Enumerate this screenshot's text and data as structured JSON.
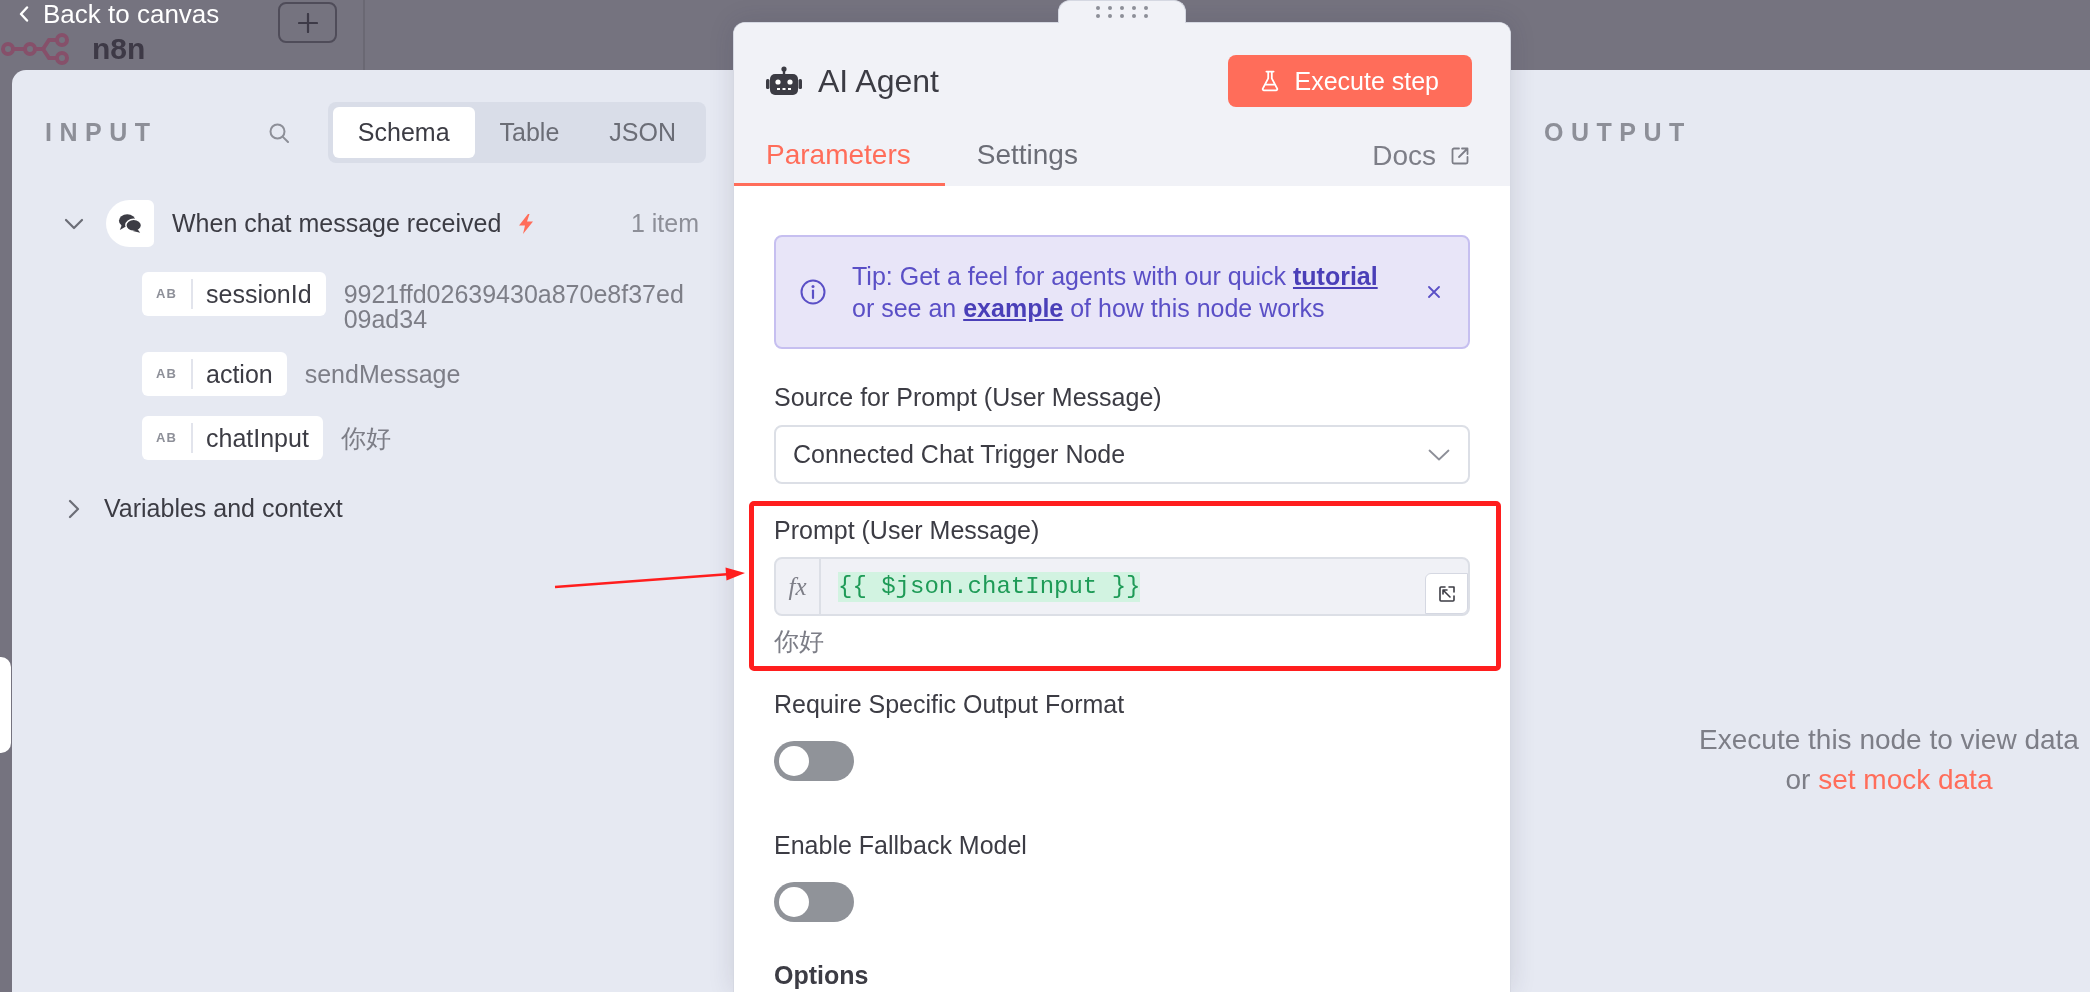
{
  "header": {
    "back_label": "Back to canvas",
    "brand": "n8n"
  },
  "input_panel": {
    "title": "INPUT",
    "views": [
      {
        "label": "Schema",
        "selected": true
      },
      {
        "label": "Table",
        "selected": false
      },
      {
        "label": "JSON",
        "selected": false
      }
    ],
    "tree": [
      {
        "kind": "node",
        "label": "When chat message received",
        "trigger": true,
        "expanded": true,
        "count": "1 item",
        "children": [
          {
            "kind": "field",
            "badge": "AB",
            "name": "sessionId",
            "value": "9921ffd02639430a870e8f37ed09ad34"
          },
          {
            "kind": "field",
            "badge": "AB",
            "name": "action",
            "value": "sendMessage"
          },
          {
            "kind": "field",
            "badge": "AB",
            "name": "chatInput",
            "value": "你好"
          }
        ]
      },
      {
        "kind": "group",
        "label": "Variables and context",
        "expanded": false
      }
    ]
  },
  "node_panel": {
    "title": "AI Agent",
    "execute_label": "Execute step",
    "tabs": [
      {
        "label": "Parameters",
        "selected": true
      },
      {
        "label": "Settings",
        "selected": false
      }
    ],
    "docs_label": "Docs",
    "tip": {
      "lines": [
        [
          {
            "kind": "text",
            "text": "Tip: Get a feel for agents with our quick "
          },
          {
            "kind": "link",
            "text": "tutorial"
          }
        ],
        [
          {
            "kind": "text",
            "text": "or see an "
          },
          {
            "kind": "link",
            "text": "example"
          },
          {
            "kind": "text",
            "text": " of how this node works"
          }
        ]
      ]
    },
    "parameters": [
      {
        "kind": "select",
        "label": "Source for Prompt (User Message)",
        "value": "Connected Chat Trigger Node"
      },
      {
        "kind": "expression",
        "label": "Prompt (User Message)",
        "mode_label": "fx",
        "expression": "{{ $json.chatInput }}",
        "result": "你好",
        "highlighted": true
      },
      {
        "kind": "toggle",
        "label": "Require Specific Output Format",
        "on": false
      },
      {
        "kind": "toggle",
        "label": "Enable Fallback Model",
        "on": false
      },
      {
        "kind": "section",
        "label": "Options"
      }
    ]
  },
  "output_panel": {
    "title": "OUTPUT",
    "empty_lines": [
      [
        {
          "kind": "text",
          "text": "Execute this node to view data"
        }
      ],
      [
        {
          "kind": "text",
          "text": "or "
        },
        {
          "kind": "link",
          "text": "set mock data"
        }
      ]
    ]
  }
}
